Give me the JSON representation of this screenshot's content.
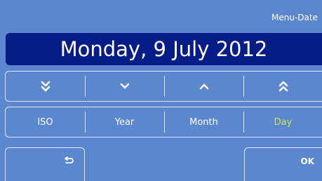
{
  "header": {
    "title": "Menu-Date"
  },
  "date_display": {
    "text": "Monday, 9 July 2012"
  },
  "arrow_row": [
    {
      "icon": "double-chevron-down-icon"
    },
    {
      "icon": "chevron-down-icon"
    },
    {
      "icon": "chevron-up-icon"
    },
    {
      "icon": "double-chevron-up-icon"
    }
  ],
  "field_row": [
    {
      "label": "ISO"
    },
    {
      "label": "Year"
    },
    {
      "label": "Month"
    },
    {
      "label": "Day",
      "selected": true
    }
  ],
  "footer": {
    "back_icon": "return-arrow-icon",
    "ok_label": "OK"
  },
  "colors": {
    "background": "#5b87cf",
    "date_bar": "#061c86",
    "selected_field": "#cfe05a",
    "border": "#dfe8f7"
  }
}
